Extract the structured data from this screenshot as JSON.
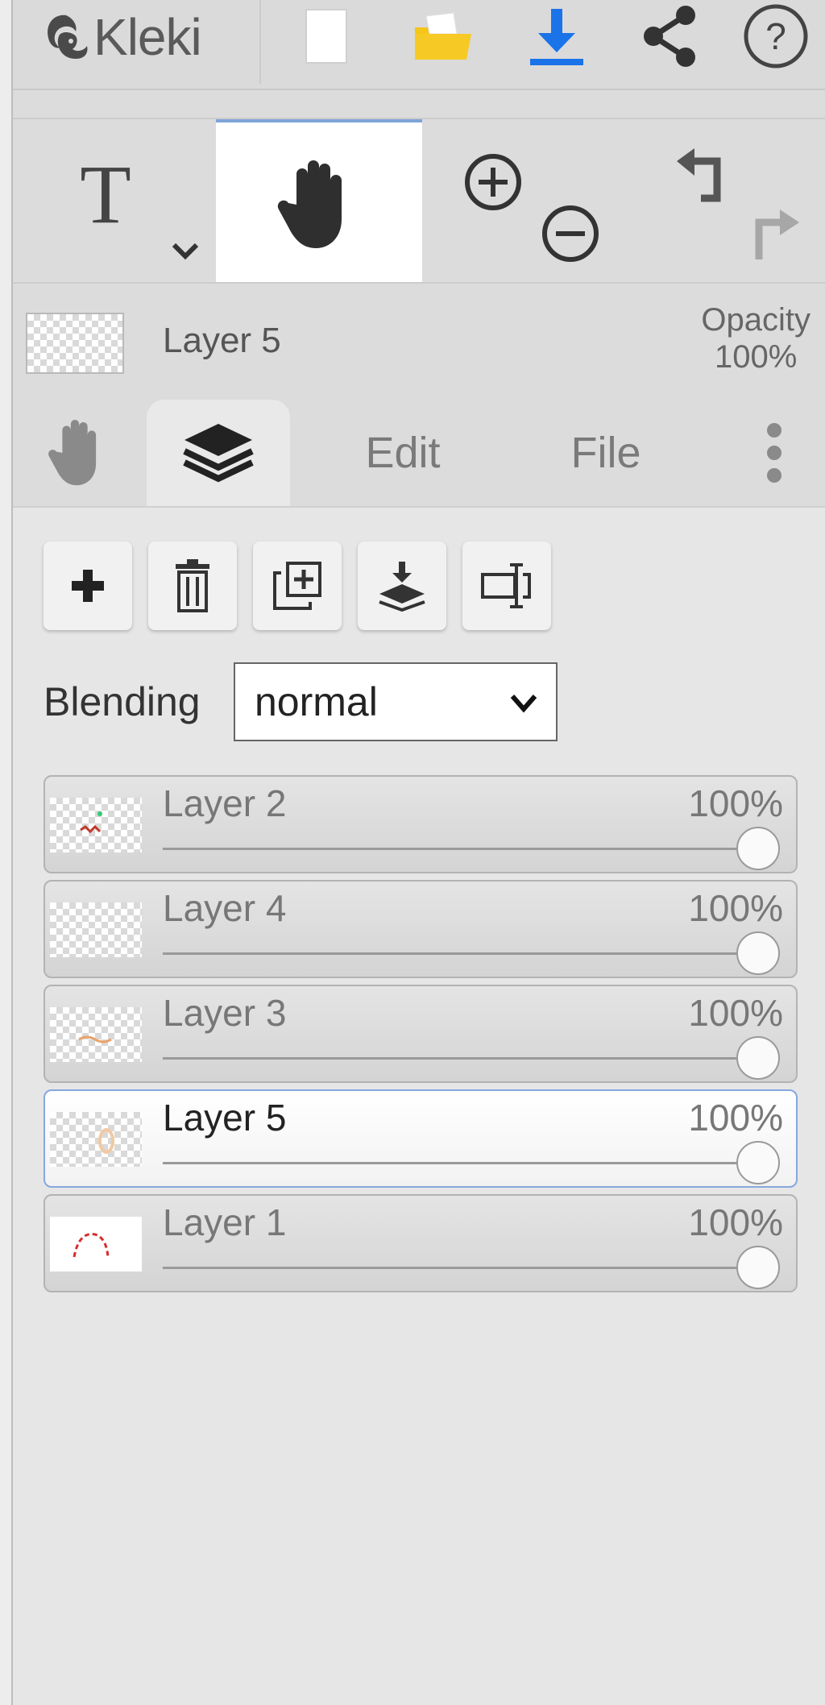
{
  "app": {
    "name": "Kleki"
  },
  "icons": {
    "logo": "kleki-squirrel-logo",
    "new": "new-page-icon",
    "open": "folder-icon",
    "download": "download-icon",
    "share": "share-icon",
    "help": "help-icon",
    "text_tool": "text-tool-icon",
    "hand_tool": "hand-icon",
    "zoom_in": "zoom-in-icon",
    "zoom_out": "zoom-out-icon",
    "undo": "undo-icon",
    "redo": "redo-icon",
    "tab_hand": "hand-icon",
    "tab_layers": "layers-icon",
    "more": "more-vertical-icon",
    "add": "plus-icon",
    "delete": "trash-icon",
    "duplicate": "duplicate-icon",
    "merge": "merge-down-icon",
    "rename": "rename-icon"
  },
  "colors": {
    "accent_blue": "#1a73e8",
    "folder_yellow": "#f5c518",
    "selected_border": "#86a8df"
  },
  "current_layer": {
    "name": "Layer 5",
    "opacity_label": "Opacity",
    "opacity_value": "100%"
  },
  "tabs": {
    "edit": "Edit",
    "file": "File"
  },
  "blending": {
    "label": "Blending",
    "value": "normal"
  },
  "layers": [
    {
      "name": "Layer 2",
      "opacity": "100%",
      "selected": false
    },
    {
      "name": "Layer 4",
      "opacity": "100%",
      "selected": false
    },
    {
      "name": "Layer 3",
      "opacity": "100%",
      "selected": false
    },
    {
      "name": "Layer 5",
      "opacity": "100%",
      "selected": true
    },
    {
      "name": "Layer 1",
      "opacity": "100%",
      "selected": false
    }
  ]
}
